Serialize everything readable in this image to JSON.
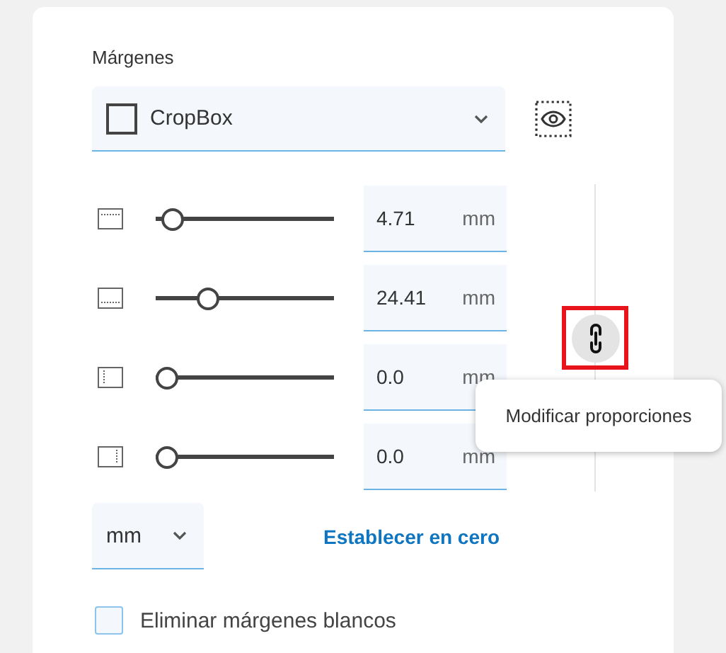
{
  "section_title": "Márgenes",
  "box_select": {
    "value": "CropBox"
  },
  "margins": [
    {
      "kind": "top",
      "level": 0.04,
      "value": "4.71",
      "unit": "mm"
    },
    {
      "kind": "bottom",
      "level": 0.26,
      "value": "24.41",
      "unit": "mm"
    },
    {
      "kind": "left",
      "level": 0,
      "value": "0.0",
      "unit": "mm"
    },
    {
      "kind": "right",
      "level": 0,
      "value": "0.0",
      "unit": "mm"
    }
  ],
  "link_button": {
    "highlighted": true
  },
  "tooltip": "Modificar proporciones",
  "unit_select": {
    "value": "mm"
  },
  "reset_link": "Establecer en cero",
  "remove_white_margins": {
    "label": "Eliminar márgenes blancos",
    "checked": false
  }
}
